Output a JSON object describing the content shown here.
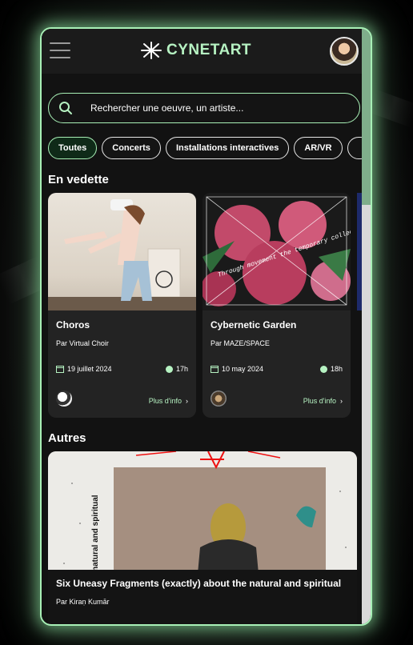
{
  "app": {
    "name": "CYNETART",
    "accent": "#b6f2c2"
  },
  "search": {
    "placeholder": "Rechercher une oeuvre, un artiste..."
  },
  "filters": [
    "Toutes",
    "Concerts",
    "Installations interactives",
    "AR/VR"
  ],
  "sections": {
    "featured": "En vedette",
    "others": "Autres"
  },
  "featured": [
    {
      "title": "Choros",
      "artist": "Par Virtual Choir",
      "date": "19 juillet 2024",
      "time": "17h",
      "more": "Plus d'info"
    },
    {
      "title": "Cybernetic Garden",
      "artist": "Par MAZE/SPACE",
      "date": "10 may 2024",
      "time": "18h",
      "more": "Plus d'info"
    }
  ],
  "others": [
    {
      "title": "Six Uneasy Fragments (exactly) about the natural and spiritual",
      "artist": "Par Kiraṇ Kumār"
    }
  ],
  "image_text": {
    "garden_overlay": "Through movement the temporary collective is constantly becoming.",
    "fragments_side": "natural and spiritual"
  }
}
